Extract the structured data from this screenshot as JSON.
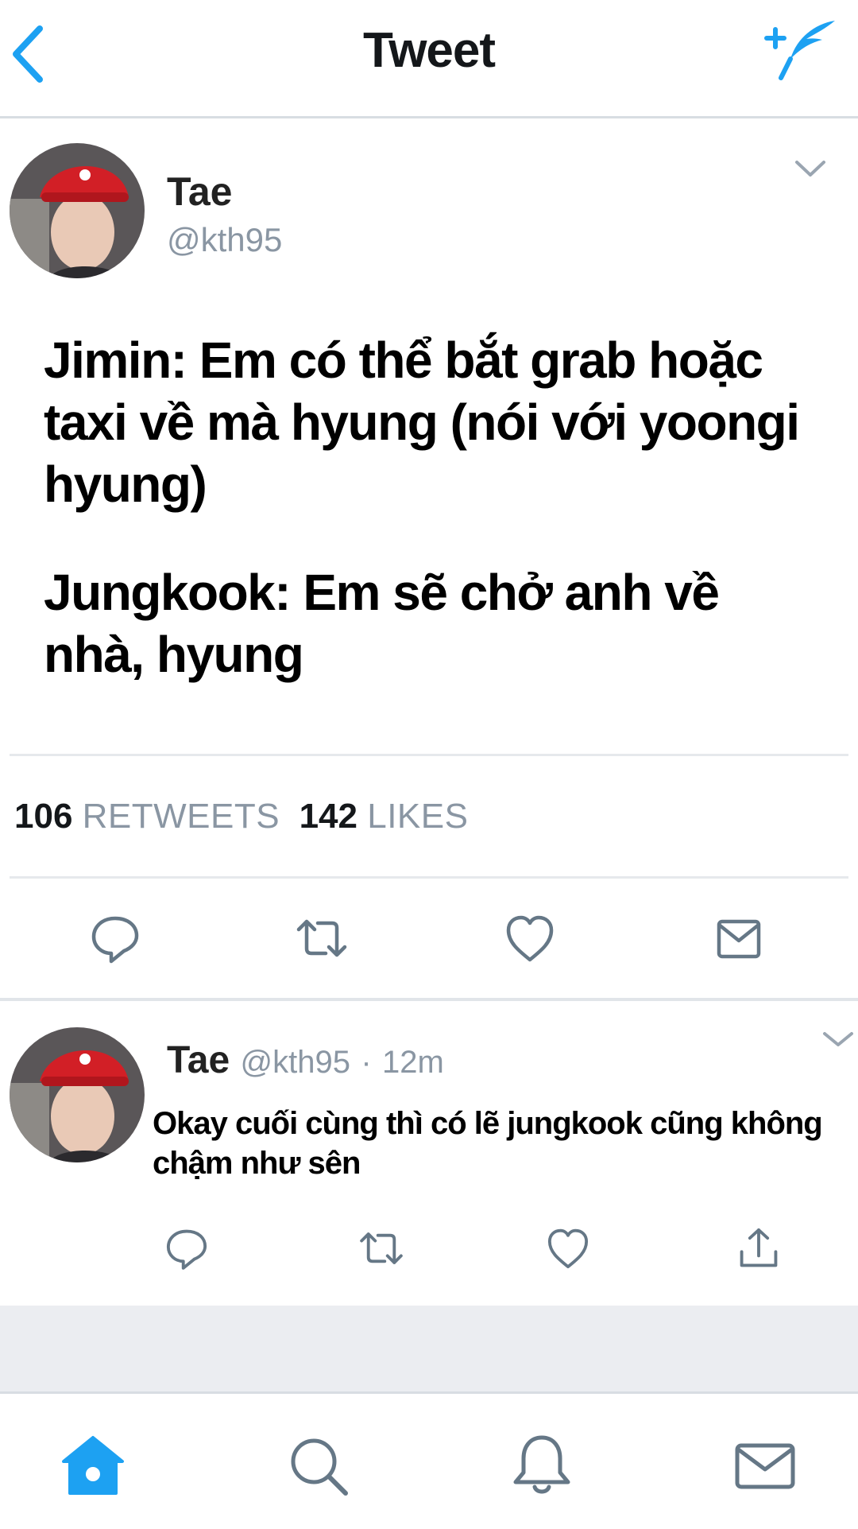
{
  "header": {
    "title": "Tweet"
  },
  "main_tweet": {
    "name": "Tae",
    "handle": "@kth95",
    "paragraph_1": "Jimin: Em có thể bắt grab hoặc taxi về mà hyung (nói với yoongi hyung)",
    "paragraph_2": "Jungkook: Em sẽ chở anh về nhà, hyung",
    "retweets_count": "106",
    "retweets_label": "RETWEETS",
    "likes_count": "142",
    "likes_label": "LIKES"
  },
  "reply_tweet": {
    "name": "Tae",
    "handle": "@kth95",
    "separator": "·",
    "time": "12m",
    "text": "Okay cuối cùng thì có lẽ jungkook cũng không chậm như sên"
  },
  "colors": {
    "accent": "#1da1f2",
    "icon_grey": "#657786",
    "muted_text": "#8a96a3",
    "divider": "#e6e9ec",
    "band": "#ebedf1"
  },
  "icons": {
    "header": [
      "back-chevron-icon",
      "compose-tweet-icon"
    ],
    "actions": [
      "reply-icon",
      "retweet-icon",
      "like-icon",
      "direct-message-icon"
    ],
    "reply_actions": [
      "reply-icon",
      "retweet-icon",
      "like-icon",
      "share-icon"
    ],
    "tabs": [
      "home-icon",
      "search-icon",
      "notifications-icon",
      "messages-icon"
    ]
  }
}
